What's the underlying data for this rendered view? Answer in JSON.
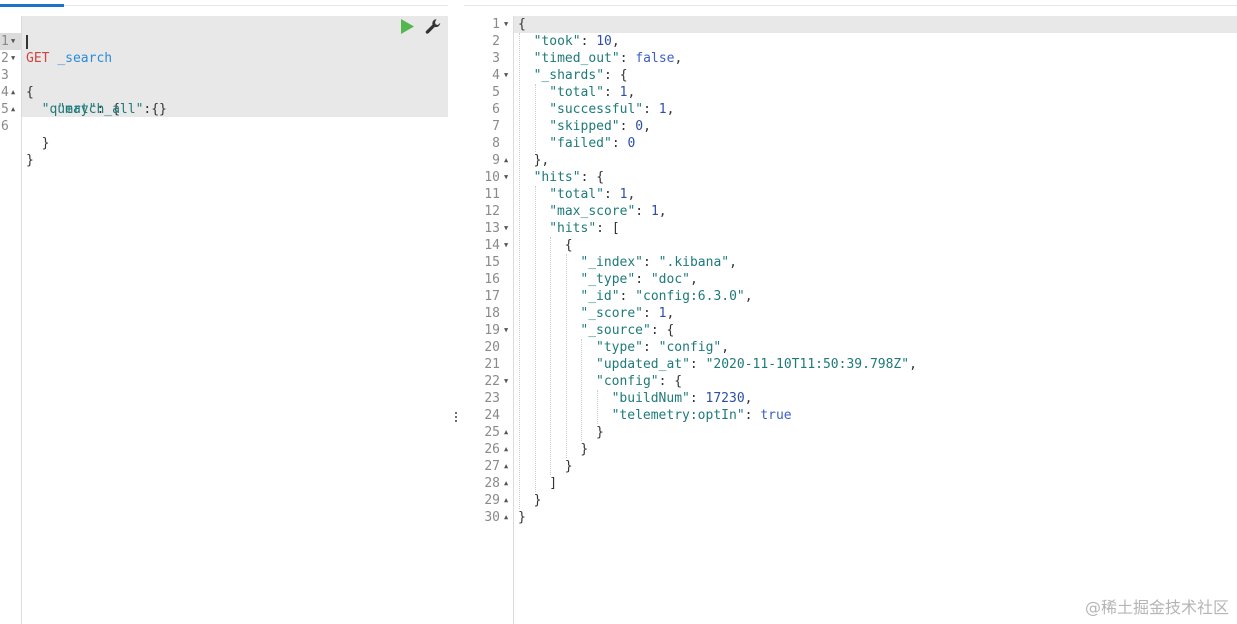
{
  "request_editor": {
    "method": "GET",
    "path": "_search",
    "lines": [
      {
        "num": "1",
        "fold": ""
      },
      {
        "num": "2",
        "fold": "▼"
      },
      {
        "num": "3",
        "fold": "▼"
      },
      {
        "num": "4",
        "fold": ""
      },
      {
        "num": "5",
        "fold": "▲"
      },
      {
        "num": "6",
        "fold": "▲"
      }
    ],
    "code": {
      "l2": "{",
      "l3_key": "\"query\"",
      "l3_rest": ": {",
      "l4_key": "\"match_all\"",
      "l4_rest": ":{}",
      "l5": "}",
      "l6": "}"
    },
    "run_icon": "play-icon",
    "settings_icon": "wrench-icon"
  },
  "response_viewer": {
    "line_numbers": [
      "1",
      "2",
      "3",
      "4",
      "5",
      "6",
      "7",
      "8",
      "9",
      "10",
      "11",
      "12",
      "13",
      "14",
      "15",
      "16",
      "17",
      "18",
      "19",
      "20",
      "21",
      "22",
      "23",
      "24",
      "25",
      "26",
      "27",
      "28",
      "29",
      "30"
    ],
    "folds": [
      "▼",
      "",
      "",
      "▼",
      "",
      "",
      "",
      "",
      "▲",
      "▼",
      "",
      "",
      "▼",
      "▼",
      "",
      "",
      "",
      "",
      "▼",
      "",
      "",
      "▼",
      "",
      "",
      "▲",
      "▲",
      "▲",
      "▲",
      "▲",
      "▲"
    ],
    "rows": [
      {
        "k": "",
        "v": "{"
      },
      {
        "k": "\"took\"",
        "v": 10,
        "sep": ": ",
        "end": ","
      },
      {
        "k": "\"timed_out\"",
        "v": "false",
        "sep": ": ",
        "end": ","
      },
      {
        "k": "\"_shards\"",
        "v": "{",
        "sep": ": ",
        "end": ""
      },
      {
        "k": "\"total\"",
        "v": 1,
        "sep": ": ",
        "end": ","
      },
      {
        "k": "\"successful\"",
        "v": 1,
        "sep": ": ",
        "end": ","
      },
      {
        "k": "\"skipped\"",
        "v": 0,
        "sep": ": ",
        "end": ","
      },
      {
        "k": "\"failed\"",
        "v": 0,
        "sep": ": ",
        "end": ""
      },
      {
        "k": "",
        "v": "},"
      },
      {
        "k": "\"hits\"",
        "v": "{",
        "sep": ": ",
        "end": ""
      },
      {
        "k": "\"total\"",
        "v": 1,
        "sep": ": ",
        "end": ","
      },
      {
        "k": "\"max_score\"",
        "v": 1,
        "sep": ": ",
        "end": ","
      },
      {
        "k": "\"hits\"",
        "v": "[",
        "sep": ": ",
        "end": ""
      },
      {
        "k": "",
        "v": "{"
      },
      {
        "k": "\"_index\"",
        "v": "\".kibana\"",
        "sep": ": ",
        "end": ","
      },
      {
        "k": "\"_type\"",
        "v": "\"doc\"",
        "sep": ": ",
        "end": ","
      },
      {
        "k": "\"_id\"",
        "v": "\"config:6.3.0\"",
        "sep": ": ",
        "end": ","
      },
      {
        "k": "\"_score\"",
        "v": 1,
        "sep": ": ",
        "end": ","
      },
      {
        "k": "\"_source\"",
        "v": "{",
        "sep": ": ",
        "end": ""
      },
      {
        "k": "\"type\"",
        "v": "\"config\"",
        "sep": ": ",
        "end": ","
      },
      {
        "k": "\"updated_at\"",
        "v": "\"2020-11-10T11:50:39.798Z\"",
        "sep": ": ",
        "end": ","
      },
      {
        "k": "\"config\"",
        "v": "{",
        "sep": ": ",
        "end": ""
      },
      {
        "k": "\"buildNum\"",
        "v": 17230,
        "sep": ": ",
        "end": ","
      },
      {
        "k": "\"telemetry:optIn\"",
        "v": "true",
        "sep": ": ",
        "end": ""
      },
      {
        "k": "",
        "v": "}"
      },
      {
        "k": "",
        "v": "}"
      },
      {
        "k": "",
        "v": "}"
      },
      {
        "k": "",
        "v": "]"
      },
      {
        "k": "",
        "v": "}"
      },
      {
        "k": "",
        "v": "}"
      }
    ]
  },
  "watermark": "@稀土掘金技术社区",
  "colors": {
    "method": "#d0463f",
    "path": "#2b8bd6",
    "key": "#1f7a7a",
    "number": "#2b4fa8",
    "boolean": "#3c5fc4",
    "active_line_bg": "#e8e8e8",
    "tab_underline": "#1a73c8"
  }
}
